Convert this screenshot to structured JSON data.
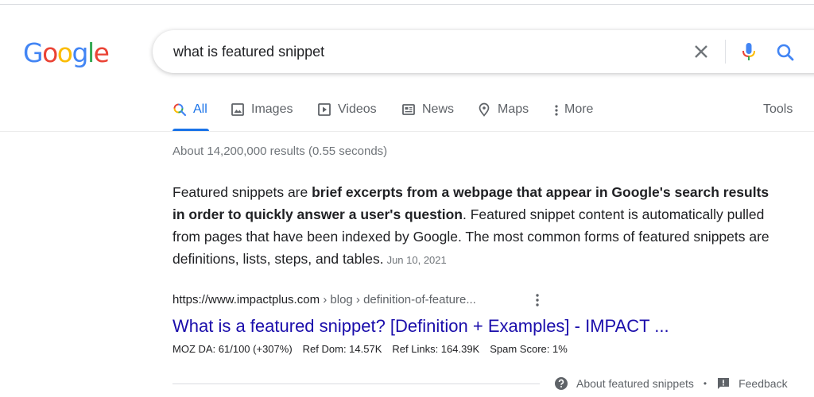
{
  "logo": {
    "letters": [
      {
        "char": "G",
        "color": "#4285f4"
      },
      {
        "char": "o",
        "color": "#ea4335"
      },
      {
        "char": "o",
        "color": "#fbbc05"
      },
      {
        "char": "g",
        "color": "#4285f4"
      },
      {
        "char": "l",
        "color": "#34a853"
      },
      {
        "char": "e",
        "color": "#ea4335"
      }
    ]
  },
  "search": {
    "query": "what is featured snippet",
    "icons": {
      "clear": "close-icon",
      "voice": "microphone-icon",
      "submit": "search-icon"
    }
  },
  "tabs": [
    {
      "label": "All",
      "icon": "search-icon",
      "active": true
    },
    {
      "label": "Images",
      "icon": "image-icon",
      "active": false
    },
    {
      "label": "Videos",
      "icon": "play-icon",
      "active": false
    },
    {
      "label": "News",
      "icon": "newspaper-icon",
      "active": false
    },
    {
      "label": "Maps",
      "icon": "map-pin-icon",
      "active": false
    },
    {
      "label": "More",
      "icon": "more-vert-icon",
      "active": false
    }
  ],
  "tools_label": "Tools",
  "result_stats": "About 14,200,000 results (0.55 seconds)",
  "snippet": {
    "text_before": "Featured snippets are ",
    "text_bold": "brief excerpts from a webpage that appear in Google's search results in order to quickly answer a user's question",
    "text_after": ". Featured snippet content is automatically pulled from pages that have been indexed by Google. The most common forms of featured snippets are definitions, lists, steps, and tables.",
    "date": "Jun 10, 2021"
  },
  "result": {
    "url_host": "https://www.impactplus.com",
    "url_crumbs": " › blog › definition-of-feature...",
    "title": "What is a featured snippet? [Definition + Examples] - IMPACT ...",
    "moz": {
      "da": "MOZ DA: 61/100 (+307%)",
      "ref_dom": "Ref Dom: 14.57K",
      "ref_links": "Ref Links: 164.39K",
      "spam_score": "Spam Score: 1%"
    }
  },
  "footer": {
    "about": "About featured snippets",
    "separator": "•",
    "feedback": "Feedback"
  },
  "colors": {
    "accent": "#1a73e8",
    "link": "#1a0dab",
    "muted": "#70757a"
  }
}
